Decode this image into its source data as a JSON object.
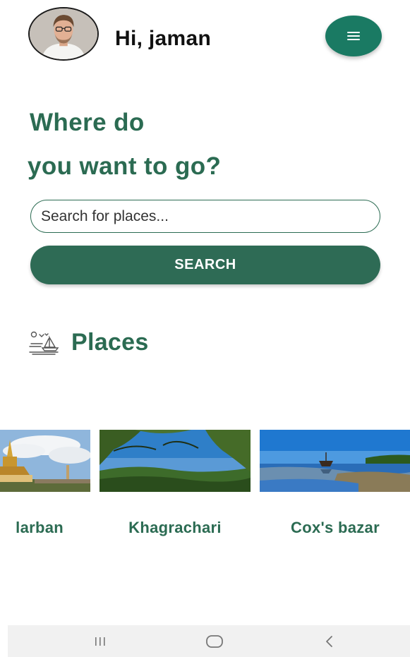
{
  "header": {
    "greeting": "Hi, jaman",
    "avatar_icon": "user-avatar",
    "menu_icon": "hamburger-menu-icon",
    "accent_color": "#1a7a63"
  },
  "hero": {
    "line1": "Where do",
    "line2": "you want to go?",
    "color": "#2b6b52"
  },
  "search": {
    "placeholder": "Search for places...",
    "value": "",
    "button_label": "SEARCH"
  },
  "places": {
    "title": "Places",
    "icon": "sailboat-landscape-icon",
    "items": [
      {
        "label": "larban",
        "image": "pagoda-photo"
      },
      {
        "label": "Khagrachari",
        "image": "hills-forest-photo"
      },
      {
        "label": "Cox's bazar",
        "image": "beach-boat-photo"
      }
    ]
  },
  "system_nav": {
    "recents_icon": "recents-icon",
    "home_icon": "home-icon",
    "back_icon": "back-icon"
  }
}
